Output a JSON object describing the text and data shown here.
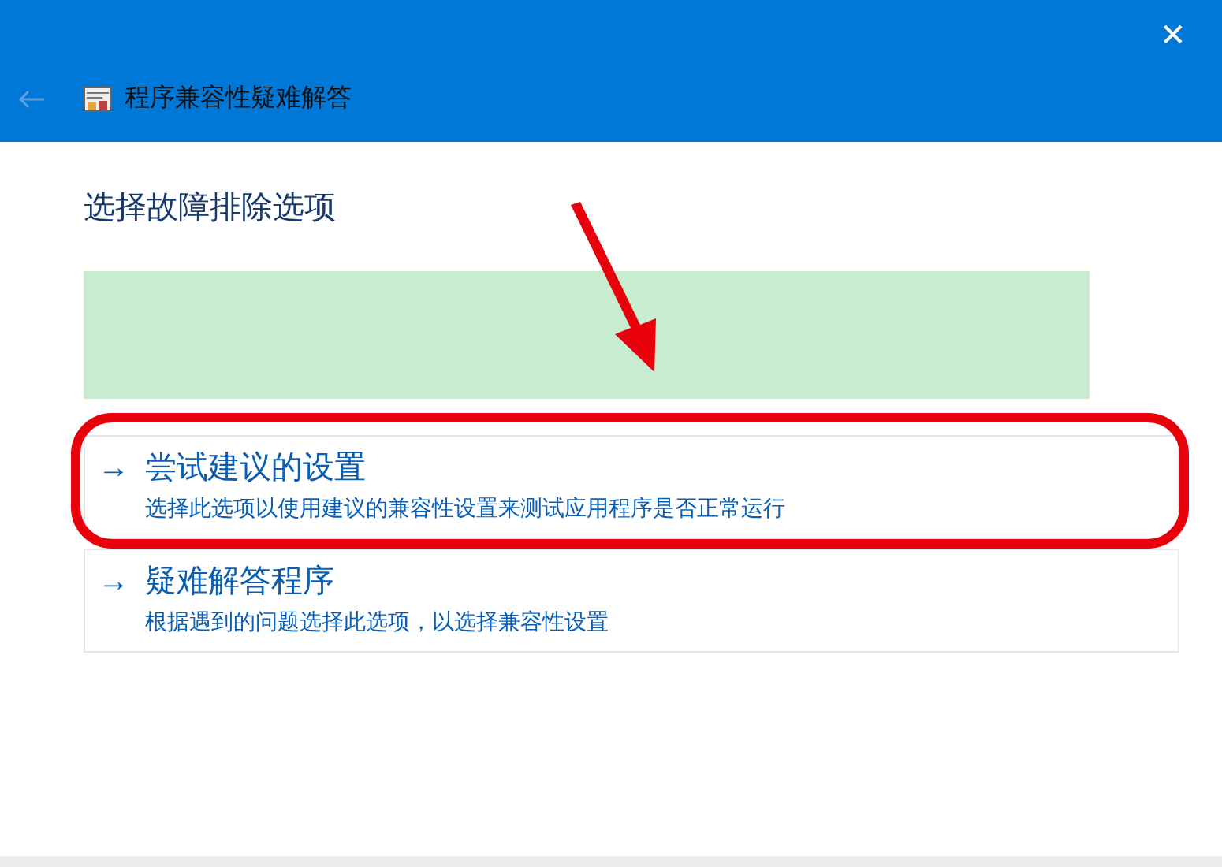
{
  "window": {
    "title": "程序兼容性疑难解答",
    "close": "✕"
  },
  "heading": "选择故障排除选项",
  "options": [
    {
      "arrow": "→",
      "title": "尝试建议的设置",
      "description": "选择此选项以使用建议的兼容性设置来测试应用程序是否正常运行",
      "highlighted": true
    },
    {
      "arrow": "→",
      "title": "疑难解答程序",
      "description": "根据遇到的问题选择此选项，以选择兼容性设置",
      "highlighted": false
    }
  ]
}
